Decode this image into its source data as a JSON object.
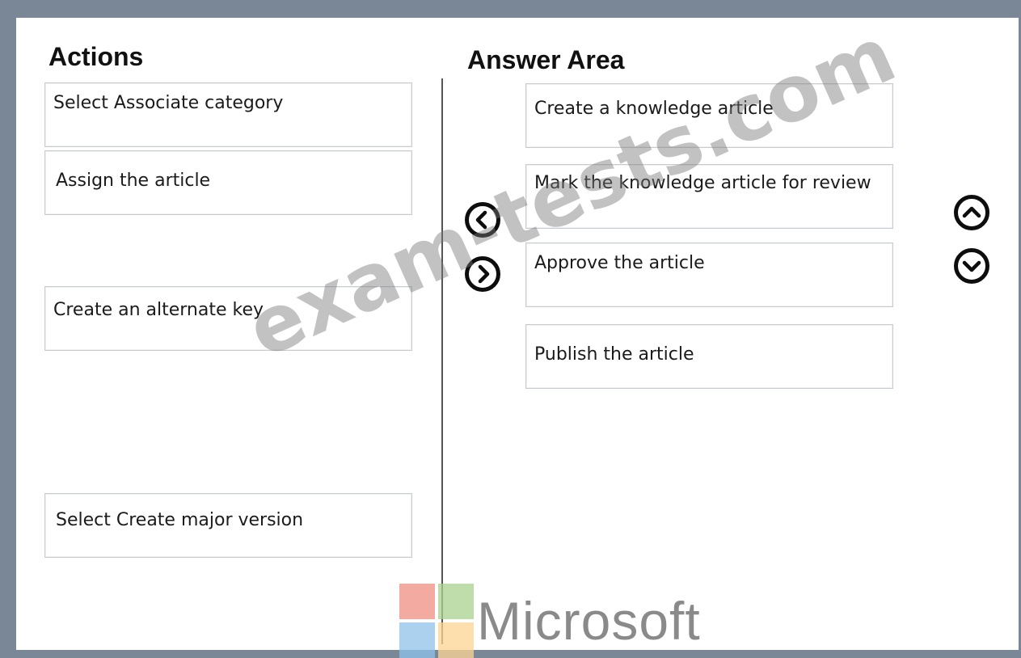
{
  "headings": {
    "actions": "Actions",
    "answer_area": "Answer Area"
  },
  "actions": [
    {
      "label": "Select  Associate category"
    },
    {
      "label": "Assign the article"
    },
    {
      "label": "Create an alternate key"
    },
    {
      "label": "Select Create major version"
    }
  ],
  "answer_area": [
    {
      "label": "Create a knowledge article"
    },
    {
      "label": "Mark the knowledge article for review"
    },
    {
      "label": "Approve the article"
    },
    {
      "label": "Publish the article"
    }
  ],
  "controls": {
    "move_left_icon": "chevron-left-circle",
    "move_right_icon": "chevron-right-circle",
    "move_up_icon": "chevron-up-circle",
    "move_down_icon": "chevron-down-circle"
  },
  "watermark": {
    "text": "exam-tests.com"
  },
  "branding": {
    "name": "Microsoft",
    "colors": {
      "red": "#f25022",
      "green": "#7fba00",
      "blue": "#00a4ef",
      "yellow": "#ffb900"
    }
  }
}
